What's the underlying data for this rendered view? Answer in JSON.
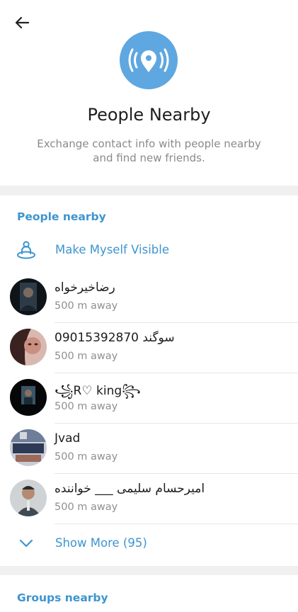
{
  "header": {
    "back_icon": "arrow-left-icon",
    "hero_icon": "location-broadcast-icon",
    "title": "People Nearby",
    "subtitle": "Exchange contact info with people nearby and find new friends."
  },
  "people_section": {
    "title": "People nearby",
    "make_visible_label": "Make Myself Visible",
    "make_visible_icon": "person-broadcast-icon",
    "people": [
      {
        "name": "رضاخیرخواه",
        "distance": "500 m away",
        "avatar_color": "#2c3b47"
      },
      {
        "name": "سوگند 09015392870",
        "distance": "500 m away",
        "avatar_color": "#6b3a36"
      },
      {
        "name": "꧁R♡ king꧂",
        "distance": "500 m away",
        "avatar_color": "#1d2a33"
      },
      {
        "name": "Jvad",
        "distance": "500 m away",
        "avatar_color": "#5b6e8a"
      },
      {
        "name": "امیرحسام سلیمی ___ خواننده",
        "distance": "500 m away",
        "avatar_color": "#3f4a52"
      }
    ],
    "show_more_label": "Show More (95)"
  },
  "groups_section": {
    "title": "Groups nearby"
  },
  "colors": {
    "accent": "#3d95cf",
    "hero_circle": "#5fa7e0",
    "background": "#f0f0f0"
  }
}
